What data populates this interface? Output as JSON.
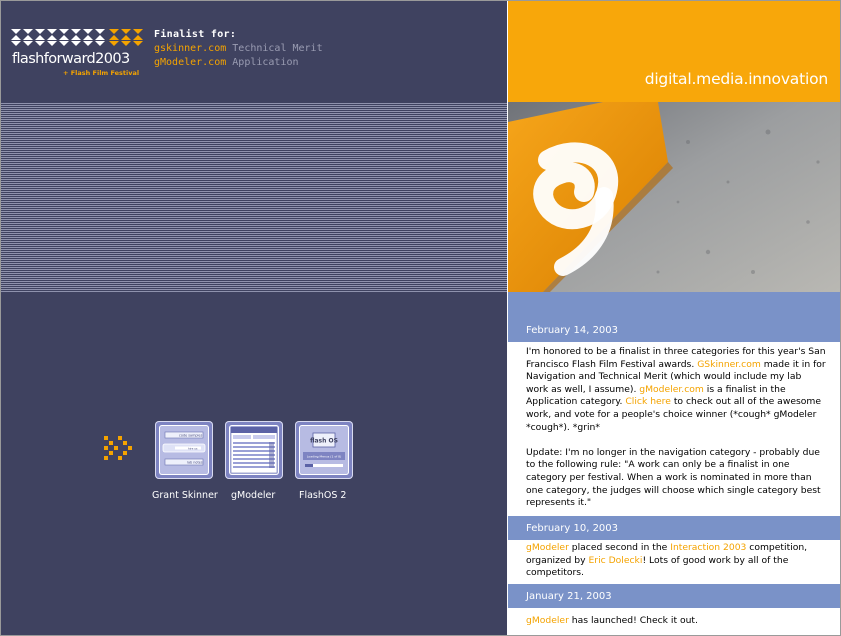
{
  "header": {
    "logo_name": "flashforward2003",
    "logo_sub": "+ Flash Film Festival",
    "finalist_heading": "Finalist for:",
    "finalist_items": [
      {
        "site": "gskinner.com",
        "category": "Technical Merit"
      },
      {
        "site": "gModeler.com",
        "category": "Application"
      }
    ]
  },
  "tagline": "digital.media.innovation",
  "apps": [
    {
      "label": "Grant Skinner",
      "icon": "grant-skinner-thumbnail-icon"
    },
    {
      "label": "gModeler",
      "icon": "gmodeler-thumbnail-icon"
    },
    {
      "label": "FlashOS 2",
      "icon": "flashos-thumbnail-icon"
    }
  ],
  "app_thumbs": {
    "grant_skinner": [
      "code samples",
      "hire us",
      "lab notes"
    ],
    "flashos": {
      "logo": "flash OS",
      "status": "Loading Menus (1 of 8)"
    }
  },
  "news": [
    {
      "date": "February 14, 2003",
      "p1": {
        "t1": "I'm honored to be a finalist in three categories for this year's San Francisco Flash Film Festival awards. ",
        "l1": "GSkinner.com",
        "t2": " made it in for Navigation and Technical Merit (which would include my lab work as well, I assume). ",
        "l2": "gModeler.com",
        "t3": " is a finalist in the Application category. ",
        "l3": "Click here",
        "t4": " to check out all of the awesome work, and vote for a people's choice winner (*cough* gModeler *cough*). *grin*"
      },
      "p2": "Update: I'm no longer in the navigation category - probably due to the following rule: \"A work can only be a finalist in one category per festival. When a work is nominated in more than one category, the judges will choose which single category best represents it.\""
    },
    {
      "date": "February 10, 2003",
      "l1": "gModeler",
      "t1": " placed second in the ",
      "l2": "Interaction 2003",
      "t2": " competition, organized by ",
      "l3": "Eric Dolecki",
      "t3": "! Lots of good work by all of the competitors."
    },
    {
      "date": "January 21, 2003",
      "l1": "gModeler",
      "t1": " has launched! Check it out."
    }
  ],
  "colors": {
    "navy": "#3f4260",
    "orange": "#f8a70a",
    "link": "#f4a300",
    "date_bar": "#7a92c8"
  }
}
